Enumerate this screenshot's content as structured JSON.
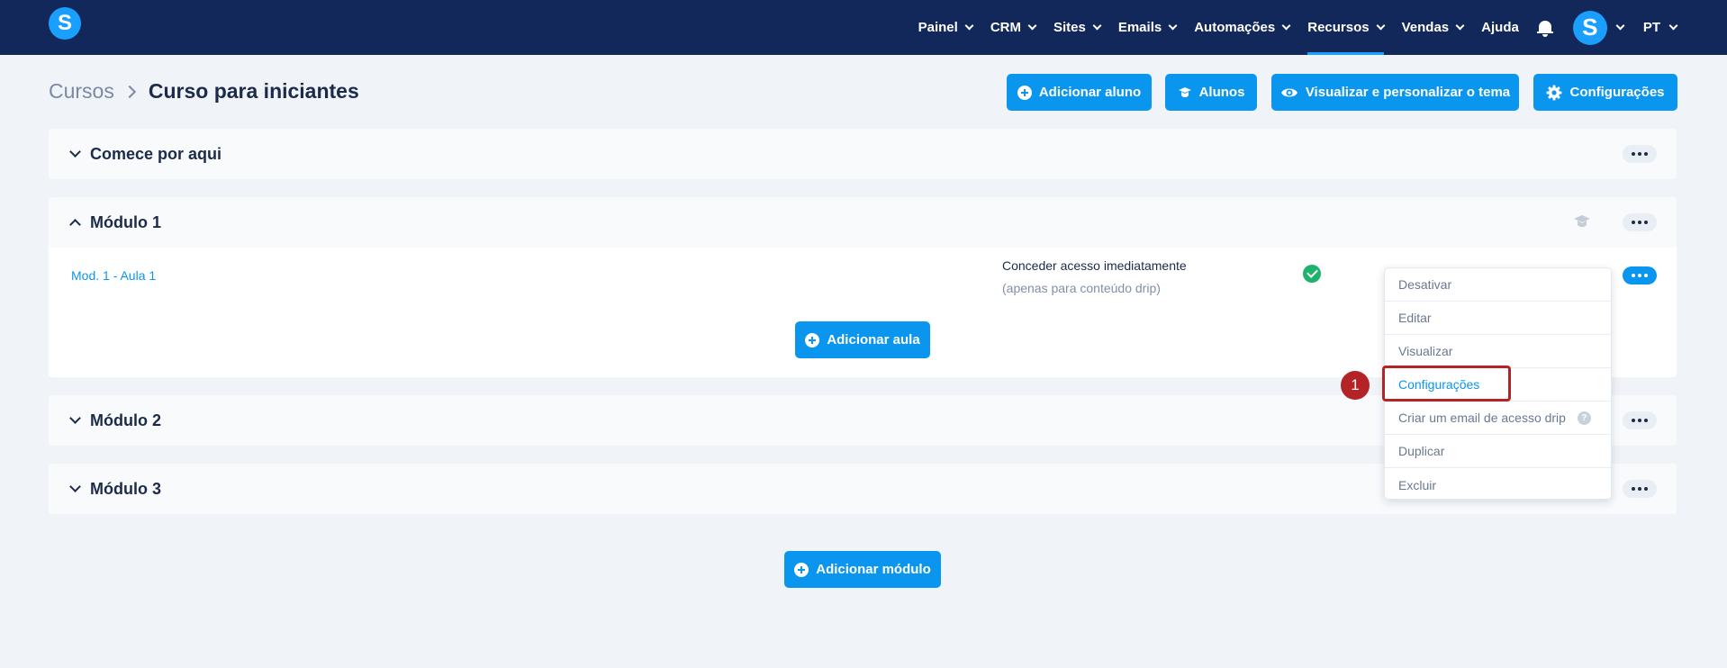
{
  "brand": {
    "logo_letter": "S",
    "accent": "#0a96ef",
    "nav_bg": "#12285a"
  },
  "nav": {
    "items": [
      {
        "label": "Painel",
        "dropdown": true
      },
      {
        "label": "CRM",
        "dropdown": true
      },
      {
        "label": "Sites",
        "dropdown": true
      },
      {
        "label": "Emails",
        "dropdown": true
      },
      {
        "label": "Automações",
        "dropdown": true
      },
      {
        "label": "Recursos",
        "dropdown": true,
        "active": true
      },
      {
        "label": "Vendas",
        "dropdown": true
      },
      {
        "label": "Ajuda",
        "dropdown": false
      }
    ],
    "avatar_letter": "S",
    "language": "PT"
  },
  "breadcrumb": {
    "root": "Cursos",
    "current": "Curso para iniciantes"
  },
  "header_buttons": {
    "add_student": "Adicionar aluno",
    "students": "Alunos",
    "theme": "Visualizar e personalizar o tema",
    "settings": "Configurações"
  },
  "modules": [
    {
      "title": "Comece por aqui",
      "expanded": false
    },
    {
      "title": "Módulo 1",
      "expanded": true,
      "lessons": [
        {
          "title": "Mod. 1 - Aula 1",
          "access": "Conceder acesso imediatamente",
          "access_note": "(apenas para conteúdo drip)",
          "status": "check-circle-icon"
        }
      ],
      "add_lesson": "Adicionar aula"
    },
    {
      "title": "Módulo 2",
      "expanded": false
    },
    {
      "title": "Módulo 3",
      "expanded": false
    }
  ],
  "lesson_menu": {
    "items": [
      "Desativar",
      "Editar",
      "Visualizar",
      "Configurações",
      "Criar um email de acesso drip",
      "Duplicar",
      "Excluir"
    ],
    "help_mark": "?"
  },
  "annotation": {
    "step": "1",
    "color": "#b42326"
  },
  "add_module": "Adicionar módulo"
}
